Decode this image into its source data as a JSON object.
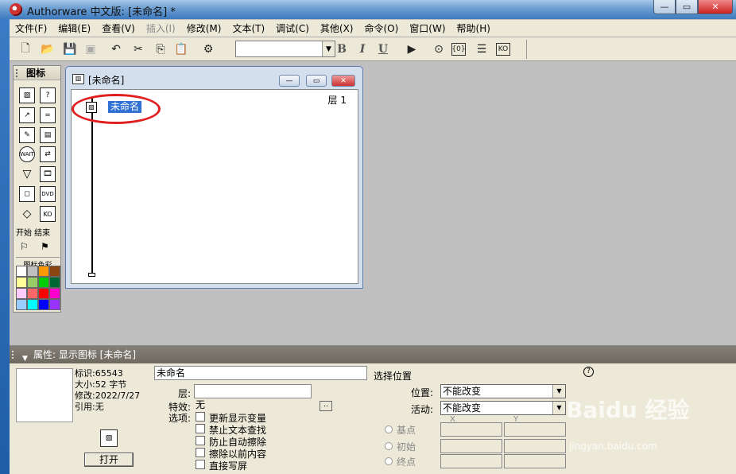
{
  "window": {
    "title": "Authorware 中文版: [未命名] *"
  },
  "menu": [
    "文件(F)",
    "编辑(E)",
    "查看(V)",
    "插入(I)",
    "修改(M)",
    "文本(T)",
    "调试(C)",
    "其他(X)",
    "命令(O)",
    "窗口(W)",
    "帮助(H)"
  ],
  "toolbar": {
    "font_value": "",
    "bold": "B",
    "italic": "I",
    "underline": "U"
  },
  "palette": {
    "title": "图标",
    "start_end": "开始 结束",
    "color_label": "图标色彩",
    "swatches": [
      "#ffffff",
      "#c0c0c0",
      "#ff9900",
      "#8b4513",
      "#ffff99",
      "#99cc66",
      "#00cc00",
      "#006633",
      "#ffccff",
      "#ff6666",
      "#ff0000",
      "#ff00cc",
      "#99ccff",
      "#00ffff",
      "#0000ff",
      "#9933ff"
    ]
  },
  "flow": {
    "title": "[未命名]",
    "layer": "层 1",
    "icon_label": "未命名"
  },
  "props": {
    "header": "属性: 显示图标 [未命名]",
    "id": "标识:65543",
    "size": "大小:52 字节",
    "modified": "修改:2022/7/27",
    "ref": "引用:无",
    "open_btn": "打开",
    "name": "未命名",
    "layer_lbl": "层:",
    "effect_lbl": "特效:",
    "effect_val": "无",
    "options_lbl": "选项:",
    "options": [
      "更新显示变量",
      "禁止文本查找",
      "防止自动擦除",
      "擦除以前内容",
      "直接写屏"
    ],
    "pos_title": "选择位置",
    "position_lbl": "位置:",
    "position_val": "不能改变",
    "active_lbl": "活动:",
    "active_val": "不能改变",
    "base": "基点",
    "initial": "初始",
    "end": "终点",
    "x": "X",
    "y": "Y",
    "help": "?"
  },
  "watermark": {
    "brand": "Baidu 经验",
    "url": "jingyan.baidu.com"
  }
}
